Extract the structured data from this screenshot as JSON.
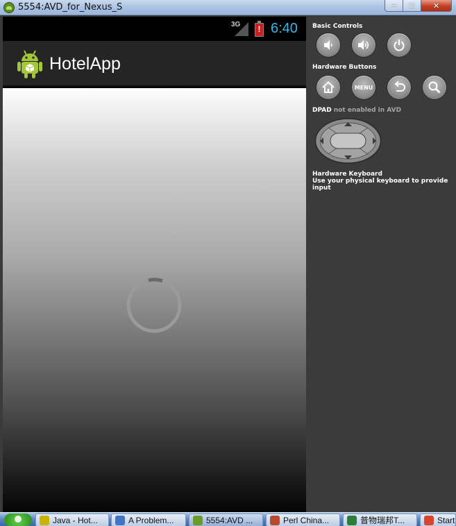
{
  "window": {
    "title": "5554:AVD_for_Nexus_S",
    "icon": "android-emulator-icon",
    "buttons": {
      "minimize": "–",
      "maximize": "□",
      "close": "✕"
    }
  },
  "device": {
    "status_bar": {
      "network": "3G",
      "time": "6:40",
      "battery_icon": "battery-low-icon",
      "battery_mark": "!"
    },
    "action_bar": {
      "app_name": "HotelApp",
      "app_icon": "android-robot-icon"
    },
    "content": {
      "loading": true,
      "spinner_icon": "progress-spinner-icon"
    }
  },
  "controls": {
    "basic_controls": {
      "label": "Basic Controls",
      "buttons": [
        "volume-down-icon",
        "volume-up-icon",
        "power-icon"
      ]
    },
    "hardware_buttons": {
      "label": "Hardware Buttons",
      "menu_label": "MENU",
      "buttons": [
        "home-icon",
        "menu",
        "back-icon",
        "search-icon"
      ]
    },
    "dpad": {
      "label": "DPAD",
      "note": "not enabled in AVD"
    },
    "keyboard": {
      "label": "Hardware Keyboard",
      "note": "Use your physical keyboard to provide input"
    }
  },
  "taskbar": {
    "items": [
      {
        "label": "Java - Hot...",
        "icon_color": "#c9b400"
      },
      {
        "label": "A Problem...",
        "icon_color": "#3f75c2"
      },
      {
        "label": "5554:AVD ...",
        "icon_color": "#6a9c2c"
      },
      {
        "label": "Perl China...",
        "icon_color": "#b84a2e"
      },
      {
        "label": "普物瑞邦T...",
        "icon_color": "#2d7d3a"
      },
      {
        "label": "Start",
        "icon_color": "#d8452c"
      }
    ]
  },
  "colors": {
    "clock": "#33b5e5",
    "panel_bg": "#3b3b3b",
    "action_bar": "#252525"
  }
}
